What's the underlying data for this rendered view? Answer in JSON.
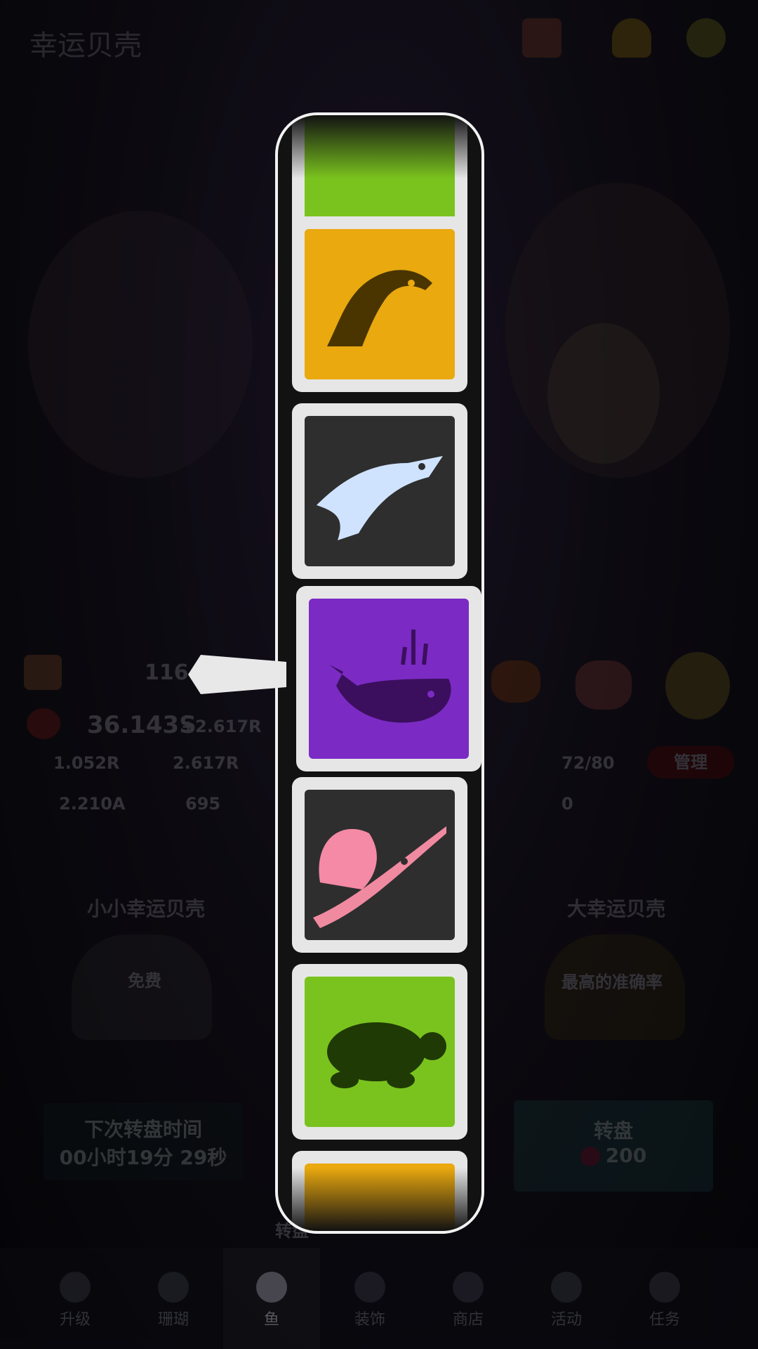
{
  "header": {
    "title": "幸运贝壳"
  },
  "stats": {
    "level": "116",
    "money": "36.143S",
    "money_rate": "+2.617R",
    "tap_value": "1.052R",
    "idle_value": "2.617R",
    "gems": "2.210A",
    "shells": "695",
    "fish_count": "72/80",
    "manage_label": "管理",
    "breed_count": "0"
  },
  "small_shell": {
    "title": "小小幸运贝壳",
    "badge": "免费",
    "next_label_1": "下次转盘时间",
    "next_label_2": "00小时19分 29秒"
  },
  "big_shell": {
    "title": "大幸运贝壳",
    "badge": "最高的准确率",
    "spin_label": "转盘",
    "cost": "200"
  },
  "footer_hint": "转盘",
  "nav": {
    "items": [
      {
        "label": "升级"
      },
      {
        "label": "珊瑚"
      },
      {
        "label": "鱼"
      },
      {
        "label": "装饰"
      },
      {
        "label": "商店"
      },
      {
        "label": "活动"
      },
      {
        "label": "任务"
      }
    ],
    "active_index": 2
  },
  "reel": {
    "tiles": [
      {
        "name": "partial-green-tile",
        "color": "#7ac31e"
      },
      {
        "name": "dolphin-silhouette",
        "color": "#e9a90f"
      },
      {
        "name": "ice-dolphin",
        "color": "#2e2e2e"
      },
      {
        "name": "whale-silhouette",
        "color": "#7b2bc4"
      },
      {
        "name": "sailfish",
        "color": "#2e2e2e"
      },
      {
        "name": "turtle-silhouette",
        "color": "#7ac31e"
      },
      {
        "name": "partial-yellow-tile",
        "color": "#e9a90f"
      }
    ],
    "selected_index": 3
  }
}
